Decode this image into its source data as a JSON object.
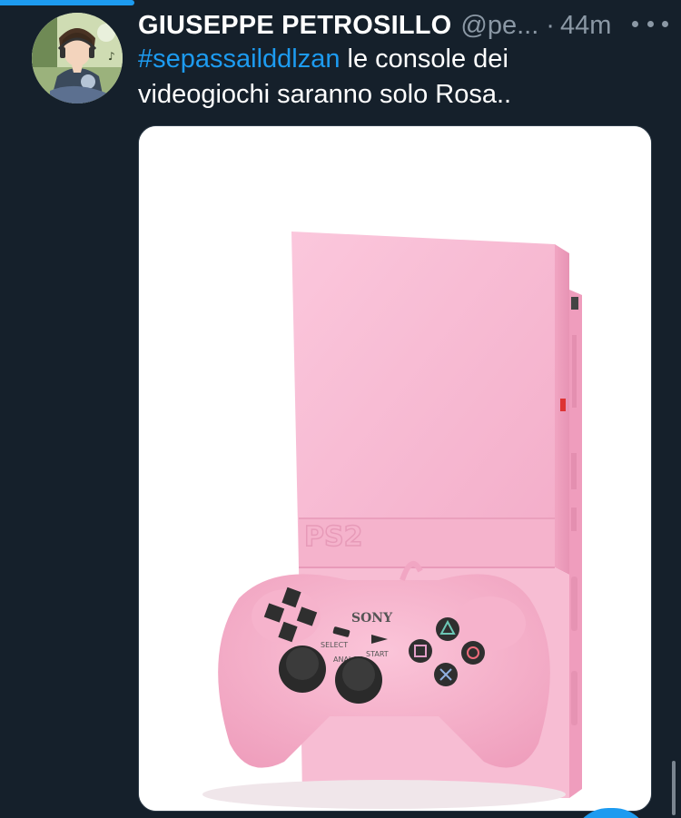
{
  "tweet": {
    "author": {
      "display_name": "GIUSEPPE PETROSILLO",
      "handle": "@pe...",
      "avatar_icon": "anime-avatar-icon"
    },
    "separator": "·",
    "timestamp": "44m",
    "more_icon": "more-dots-icon",
    "text": {
      "hashtag": "#sepassailddlzan",
      "body": " le console dei videogiochi saranno solo Rosa.."
    },
    "media": {
      "image_icon": "pink-playstation-2-console-image",
      "controller_brand": "SONY",
      "console_logo": "PS2",
      "select_label": "SELECT",
      "start_label": "START",
      "analog_label": "ANALOG"
    }
  },
  "colors": {
    "background": "#15202b",
    "text_primary": "#ffffff",
    "text_secondary": "#8b98a5",
    "accent": "#1d9bf0",
    "console_pink": "#f6b7cf"
  }
}
